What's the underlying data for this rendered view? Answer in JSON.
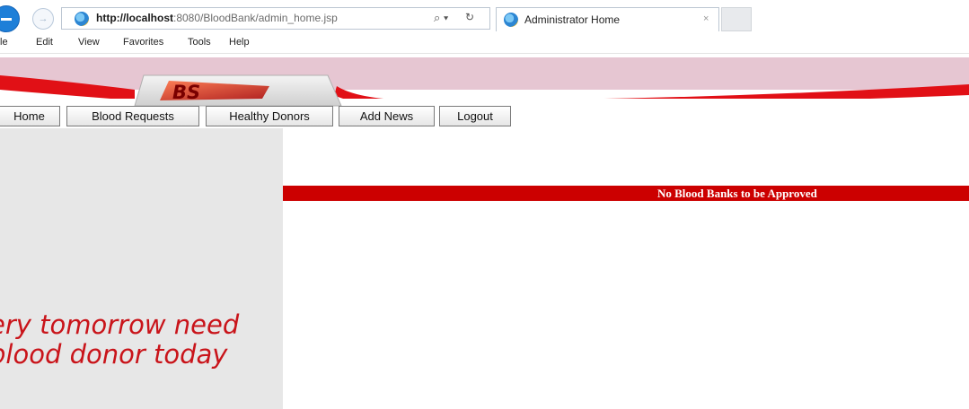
{
  "browser": {
    "url_host": "http://localhost",
    "url_rest": ":8080/BloodBank/admin_home.jsp",
    "tab_title": "Administrator Home",
    "search_glyph": "⌕ ▾",
    "refresh_glyph": "↻",
    "close_glyph": "×"
  },
  "menu": {
    "items": [
      "le",
      "Edit",
      "View",
      "Favorites",
      "Tools",
      "Help"
    ]
  },
  "page": {
    "logo_text": "BS",
    "nav": [
      "Home",
      "Blood Requests",
      "Healthy Donors",
      "Add News",
      "Logout"
    ],
    "notice": "No Blood Banks to be Approved",
    "slogan_line1": "ery tomorrow need",
    "slogan_line2": "blood donor today"
  },
  "colors": {
    "brand_red": "#cc0000",
    "banner_pink": "#e6c6d2",
    "sidebar_gray": "#e7e7e7"
  }
}
